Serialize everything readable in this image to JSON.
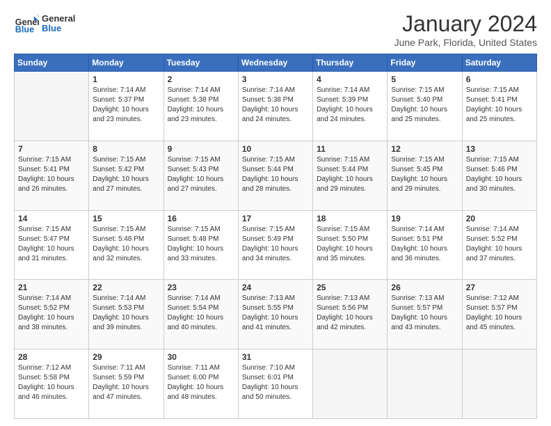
{
  "header": {
    "logo_general": "General",
    "logo_blue": "Blue",
    "month_title": "January 2024",
    "location": "June Park, Florida, United States"
  },
  "days_of_week": [
    "Sunday",
    "Monday",
    "Tuesday",
    "Wednesday",
    "Thursday",
    "Friday",
    "Saturday"
  ],
  "weeks": [
    [
      {
        "day": "",
        "empty": true
      },
      {
        "day": "1",
        "sunrise": "7:14 AM",
        "sunset": "5:37 PM",
        "daylight": "10 hours and 23 minutes."
      },
      {
        "day": "2",
        "sunrise": "7:14 AM",
        "sunset": "5:38 PM",
        "daylight": "10 hours and 23 minutes."
      },
      {
        "day": "3",
        "sunrise": "7:14 AM",
        "sunset": "5:38 PM",
        "daylight": "10 hours and 24 minutes."
      },
      {
        "day": "4",
        "sunrise": "7:14 AM",
        "sunset": "5:39 PM",
        "daylight": "10 hours and 24 minutes."
      },
      {
        "day": "5",
        "sunrise": "7:15 AM",
        "sunset": "5:40 PM",
        "daylight": "10 hours and 25 minutes."
      },
      {
        "day": "6",
        "sunrise": "7:15 AM",
        "sunset": "5:41 PM",
        "daylight": "10 hours and 25 minutes."
      }
    ],
    [
      {
        "day": "7",
        "sunrise": "7:15 AM",
        "sunset": "5:41 PM",
        "daylight": "10 hours and 26 minutes."
      },
      {
        "day": "8",
        "sunrise": "7:15 AM",
        "sunset": "5:42 PM",
        "daylight": "10 hours and 27 minutes."
      },
      {
        "day": "9",
        "sunrise": "7:15 AM",
        "sunset": "5:43 PM",
        "daylight": "10 hours and 27 minutes."
      },
      {
        "day": "10",
        "sunrise": "7:15 AM",
        "sunset": "5:44 PM",
        "daylight": "10 hours and 28 minutes."
      },
      {
        "day": "11",
        "sunrise": "7:15 AM",
        "sunset": "5:44 PM",
        "daylight": "10 hours and 29 minutes."
      },
      {
        "day": "12",
        "sunrise": "7:15 AM",
        "sunset": "5:45 PM",
        "daylight": "10 hours and 29 minutes."
      },
      {
        "day": "13",
        "sunrise": "7:15 AM",
        "sunset": "5:46 PM",
        "daylight": "10 hours and 30 minutes."
      }
    ],
    [
      {
        "day": "14",
        "sunrise": "7:15 AM",
        "sunset": "5:47 PM",
        "daylight": "10 hours and 31 minutes."
      },
      {
        "day": "15",
        "sunrise": "7:15 AM",
        "sunset": "5:48 PM",
        "daylight": "10 hours and 32 minutes."
      },
      {
        "day": "16",
        "sunrise": "7:15 AM",
        "sunset": "5:48 PM",
        "daylight": "10 hours and 33 minutes."
      },
      {
        "day": "17",
        "sunrise": "7:15 AM",
        "sunset": "5:49 PM",
        "daylight": "10 hours and 34 minutes."
      },
      {
        "day": "18",
        "sunrise": "7:15 AM",
        "sunset": "5:50 PM",
        "daylight": "10 hours and 35 minutes."
      },
      {
        "day": "19",
        "sunrise": "7:14 AM",
        "sunset": "5:51 PM",
        "daylight": "10 hours and 36 minutes."
      },
      {
        "day": "20",
        "sunrise": "7:14 AM",
        "sunset": "5:52 PM",
        "daylight": "10 hours and 37 minutes."
      }
    ],
    [
      {
        "day": "21",
        "sunrise": "7:14 AM",
        "sunset": "5:52 PM",
        "daylight": "10 hours and 38 minutes."
      },
      {
        "day": "22",
        "sunrise": "7:14 AM",
        "sunset": "5:53 PM",
        "daylight": "10 hours and 39 minutes."
      },
      {
        "day": "23",
        "sunrise": "7:14 AM",
        "sunset": "5:54 PM",
        "daylight": "10 hours and 40 minutes."
      },
      {
        "day": "24",
        "sunrise": "7:13 AM",
        "sunset": "5:55 PM",
        "daylight": "10 hours and 41 minutes."
      },
      {
        "day": "25",
        "sunrise": "7:13 AM",
        "sunset": "5:56 PM",
        "daylight": "10 hours and 42 minutes."
      },
      {
        "day": "26",
        "sunrise": "7:13 AM",
        "sunset": "5:57 PM",
        "daylight": "10 hours and 43 minutes."
      },
      {
        "day": "27",
        "sunrise": "7:12 AM",
        "sunset": "5:57 PM",
        "daylight": "10 hours and 45 minutes."
      }
    ],
    [
      {
        "day": "28",
        "sunrise": "7:12 AM",
        "sunset": "5:58 PM",
        "daylight": "10 hours and 46 minutes."
      },
      {
        "day": "29",
        "sunrise": "7:11 AM",
        "sunset": "5:59 PM",
        "daylight": "10 hours and 47 minutes."
      },
      {
        "day": "30",
        "sunrise": "7:11 AM",
        "sunset": "6:00 PM",
        "daylight": "10 hours and 48 minutes."
      },
      {
        "day": "31",
        "sunrise": "7:10 AM",
        "sunset": "6:01 PM",
        "daylight": "10 hours and 50 minutes."
      },
      {
        "day": "",
        "empty": true
      },
      {
        "day": "",
        "empty": true
      },
      {
        "day": "",
        "empty": true
      }
    ]
  ]
}
